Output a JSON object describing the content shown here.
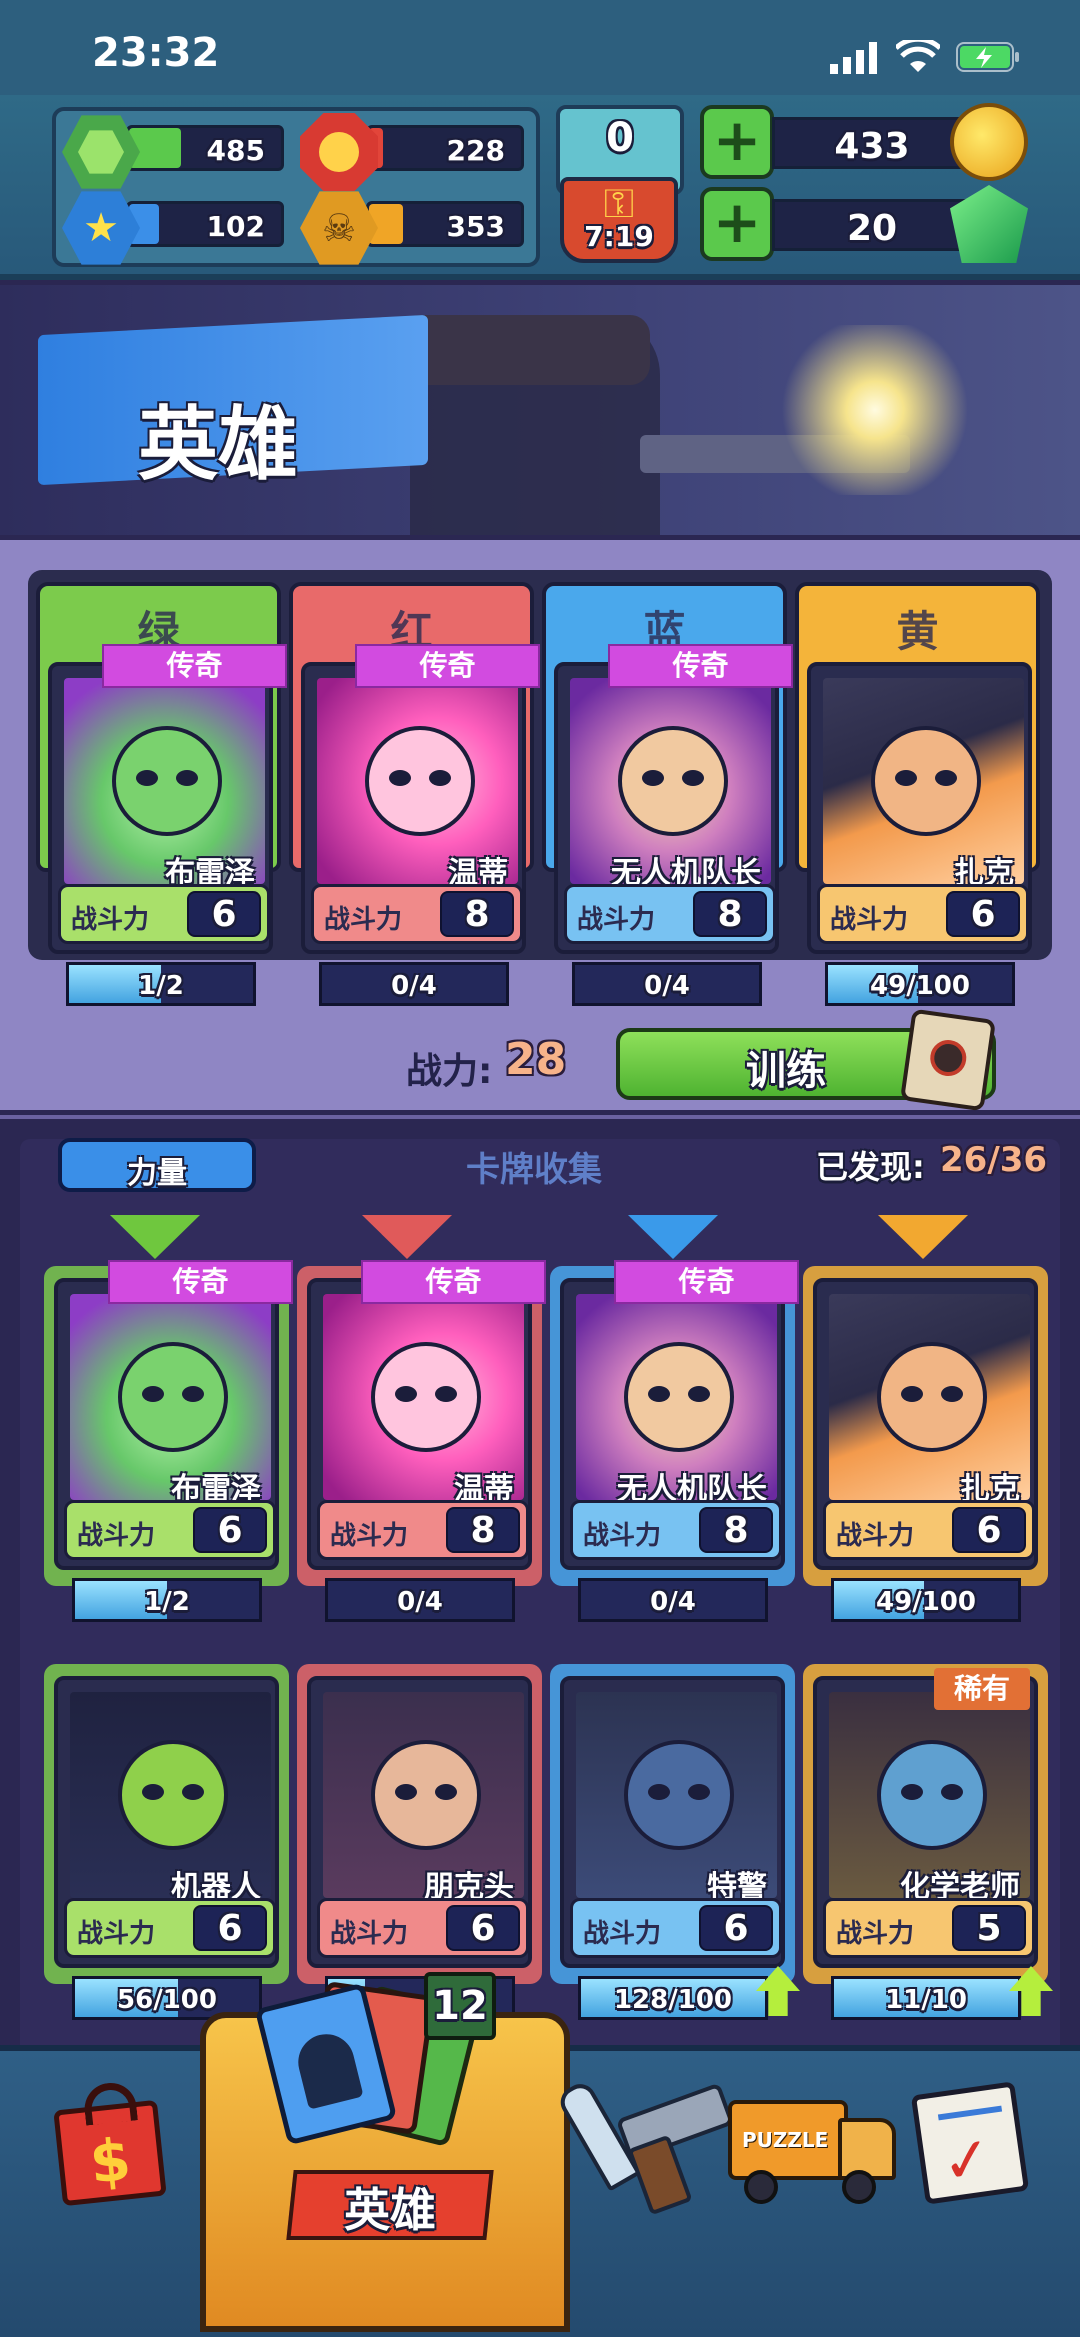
{
  "status": {
    "time": "23:32"
  },
  "resources": {
    "green": {
      "value": "485",
      "color": "#5bc94c",
      "icon": "green-hexagon-icon"
    },
    "red": {
      "value": "228",
      "color": "#e2453a",
      "icon": "red-octagon-icon"
    },
    "blue": {
      "value": "102",
      "color": "#3b8fe8",
      "icon": "blue-star-hexagon-icon"
    },
    "yellow": {
      "value": "353",
      "color": "#f0a526",
      "icon": "skull-coin-icon"
    }
  },
  "keys": {
    "count": "0",
    "timer": "7:19",
    "icon": "key-icon"
  },
  "currencies": {
    "coins": {
      "value": "433",
      "icon": "gold-coin-icon"
    },
    "gems": {
      "value": "20",
      "icon": "green-gem-icon"
    }
  },
  "banner": {
    "title": "英雄"
  },
  "team": {
    "slots": [
      {
        "label": "绿",
        "color": "#7ccb4c",
        "rarity": "传奇",
        "name": "布雷泽",
        "power_label": "战斗力",
        "power": "6",
        "progress": "1/2",
        "progress_fraction": 0.5
      },
      {
        "label": "红",
        "color": "#e86a6a",
        "rarity": "传奇",
        "name": "温蒂",
        "power_label": "战斗力",
        "power": "8",
        "progress": "0/4",
        "progress_fraction": 0
      },
      {
        "label": "蓝",
        "color": "#4aa8ec",
        "rarity": "传奇",
        "name": "无人机队长",
        "power_label": "战斗力",
        "power": "8",
        "progress": "0/4",
        "progress_fraction": 0
      },
      {
        "label": "黄",
        "color": "#f4b43a",
        "rarity": "",
        "name": "扎克",
        "power_label": "战斗力",
        "power": "6",
        "progress": "49/100",
        "progress_fraction": 0.49
      }
    ],
    "power_label": "战力:",
    "power_value": "28",
    "train_label": "训练"
  },
  "collection": {
    "sort_label": "力量",
    "title": "卡牌收集",
    "found_label": "已发现:",
    "found_value": "26/36",
    "cards": [
      {
        "name": "布雷泽",
        "rarity": "传奇",
        "badge": "",
        "power_label": "战斗力",
        "power": "6",
        "progress": "1/2",
        "progress_fraction": 0.5,
        "upgrade": false
      },
      {
        "name": "温蒂",
        "rarity": "传奇",
        "badge": "",
        "power_label": "战斗力",
        "power": "8",
        "progress": "0/4",
        "progress_fraction": 0,
        "upgrade": false
      },
      {
        "name": "无人机队长",
        "rarity": "传奇",
        "badge": "",
        "power_label": "战斗力",
        "power": "8",
        "progress": "0/4",
        "progress_fraction": 0,
        "upgrade": false
      },
      {
        "name": "扎克",
        "rarity": "",
        "badge": "",
        "power_label": "战斗力",
        "power": "6",
        "progress": "49/100",
        "progress_fraction": 0.49,
        "upgrade": false
      },
      {
        "name": "机器人",
        "rarity": "",
        "badge": "",
        "power_label": "战斗力",
        "power": "6",
        "progress": "56/100",
        "progress_fraction": 0.56,
        "upgrade": false
      },
      {
        "name": "朋克头",
        "rarity": "",
        "badge": "",
        "power_label": "战斗力",
        "power": "6",
        "progress": "",
        "progress_fraction": 0.2,
        "upgrade": false
      },
      {
        "name": "特警",
        "rarity": "",
        "badge": "",
        "power_label": "战斗力",
        "power": "6",
        "progress": "128/100",
        "progress_fraction": 1,
        "upgrade": true
      },
      {
        "name": "化学老师",
        "rarity": "",
        "badge": "稀有",
        "power_label": "战斗力",
        "power": "5",
        "progress": "11/10",
        "progress_fraction": 1,
        "upgrade": true
      }
    ]
  },
  "nav": {
    "shop_icon": "shop-bag-icon",
    "hero_label": "英雄",
    "hero_badge": "12",
    "battle_icon": "knife-revolver-icon",
    "puzzle_icon": "puzzle-truck-icon",
    "tasks_icon": "checklist-icon"
  }
}
